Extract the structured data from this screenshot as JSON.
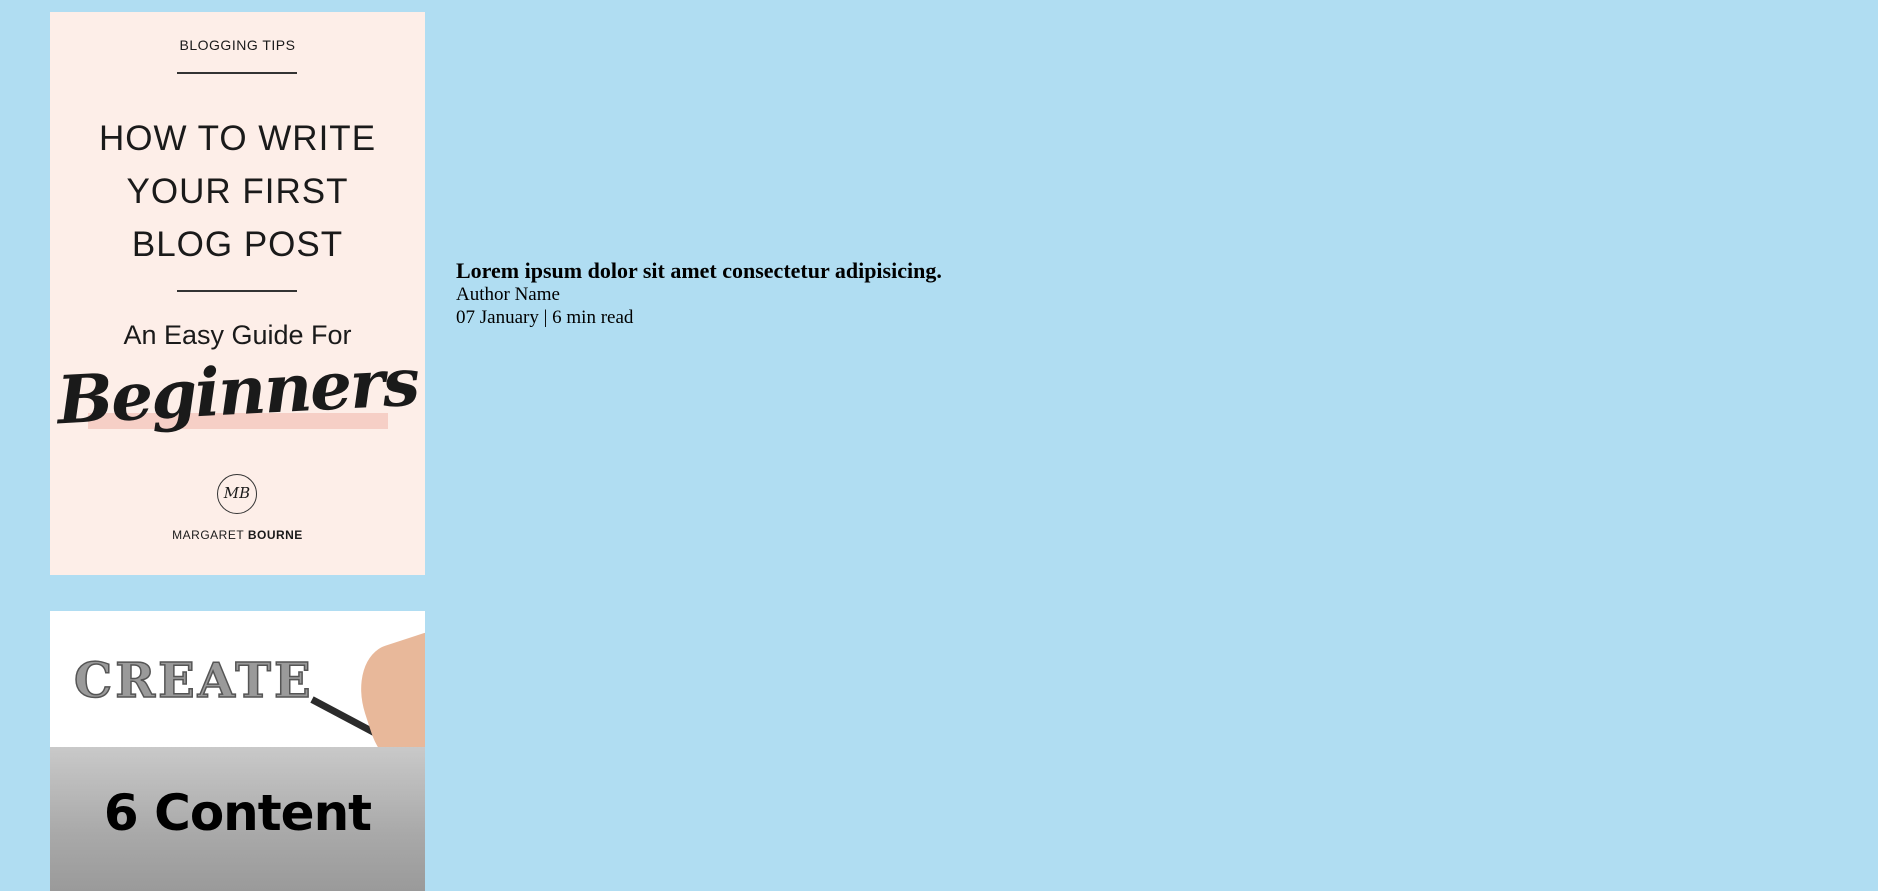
{
  "page": {
    "background": "#b0ddf2"
  },
  "posts": [
    {
      "title": "Lorem ipsum dolor sit amet consectetur adipisicing.",
      "author": "Author Name",
      "meta": "07 January | 6 min read",
      "cover": {
        "category": "BLOGGING TIPS",
        "title_lines": [
          "HOW TO WRITE",
          "YOUR FIRST",
          "BLOG POST"
        ],
        "subtitle": "An Easy Guide For",
        "script_word": "Beginners",
        "monogram": "MB",
        "author_first": "MARGARET",
        "author_last": "BOURNE",
        "colors": {
          "background": "#fdeee8",
          "text": "#1a1a1a",
          "rule": "#333333",
          "highlight": "#f6cfc6"
        }
      }
    },
    {
      "cover": {
        "headline": "CREATE",
        "subheadline": "6 Content",
        "colors": {
          "top_background": "#ffffff",
          "create_fill": "#9a9a9a",
          "skin": "#e8b89a",
          "pencil": "#2b2b2b",
          "content_text": "#000000"
        }
      }
    }
  ]
}
